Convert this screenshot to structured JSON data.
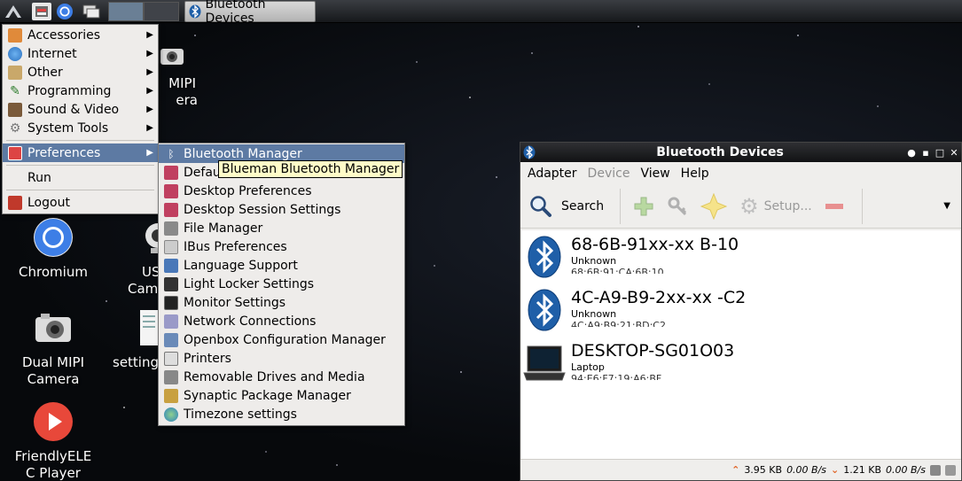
{
  "taskbar": {
    "task_title": "Bluetooth Devices"
  },
  "desktop": {
    "icons": [
      {
        "label": "MIPI Camera",
        "line1": "MIPI",
        "line2": "era"
      },
      {
        "label": "Chromium"
      },
      {
        "label": "USB Camera",
        "line1": "US",
        "line2": "Cam"
      },
      {
        "label": "Dual MIPI Camera",
        "line1": "Dual MIPI",
        "line2": "Camera"
      },
      {
        "label": "settings",
        "line1": "setting"
      },
      {
        "label": "FriendlyELEC Player",
        "line1": "FriendlyELE",
        "line2": "C Player"
      }
    ]
  },
  "main_menu": {
    "items": [
      {
        "label": "Accessories"
      },
      {
        "label": "Internet"
      },
      {
        "label": "Other"
      },
      {
        "label": "Programming"
      },
      {
        "label": "Sound & Video"
      },
      {
        "label": "System Tools"
      },
      {
        "label": "Preferences"
      },
      {
        "label": "Run"
      },
      {
        "label": "Logout"
      }
    ]
  },
  "pref_menu": {
    "items": [
      {
        "label": "Bluetooth Manager"
      },
      {
        "label": "Default Applications for LXSession"
      },
      {
        "label": "Desktop Preferences"
      },
      {
        "label": "Desktop Session Settings"
      },
      {
        "label": "File Manager"
      },
      {
        "label": "IBus Preferences"
      },
      {
        "label": "Language Support"
      },
      {
        "label": "Light Locker Settings"
      },
      {
        "label": "Monitor Settings"
      },
      {
        "label": "Network Connections"
      },
      {
        "label": "Openbox Configuration Manager"
      },
      {
        "label": "Printers"
      },
      {
        "label": "Removable Drives and Media"
      },
      {
        "label": "Synaptic Package Manager"
      },
      {
        "label": "Timezone settings"
      }
    ],
    "visible_default_fragment": "Defau"
  },
  "tooltip": {
    "text": "Blueman Bluetooth Manager"
  },
  "bt_window": {
    "title": "Bluetooth Devices",
    "menus": [
      {
        "label": "Adapter",
        "enabled": true
      },
      {
        "label": "Device",
        "enabled": false
      },
      {
        "label": "View",
        "enabled": true
      },
      {
        "label": "Help",
        "enabled": true
      }
    ],
    "toolbar": {
      "search": "Search",
      "setup": "Setup..."
    },
    "devices": [
      {
        "name": "68-6B-91xx-xx B-10",
        "type": "Unknown",
        "mac": "68:6B:91:CA:6B:10",
        "icon": "bluetooth-icon"
      },
      {
        "name": "4C-A9-B9-2xx-xx -C2",
        "type": "Unknown",
        "mac": "4C:A9:B9:21:BD:C2",
        "icon": "bluetooth-icon"
      },
      {
        "name": "DESKTOP-SG01O03",
        "type": "Laptop",
        "mac": "94:E6:F7:19:A6:BF",
        "icon": "laptop-icon"
      }
    ],
    "status": {
      "up_total": "3.95 KB",
      "up_rate": "0.00 B/s",
      "down_total": "1.21 KB",
      "down_rate": "0.00 B/s"
    }
  },
  "colors": {
    "menu_selection": "#5d7aa3",
    "bluetooth_blue": "#1f5fa8",
    "tooltip_bg": "#fffcc8"
  }
}
